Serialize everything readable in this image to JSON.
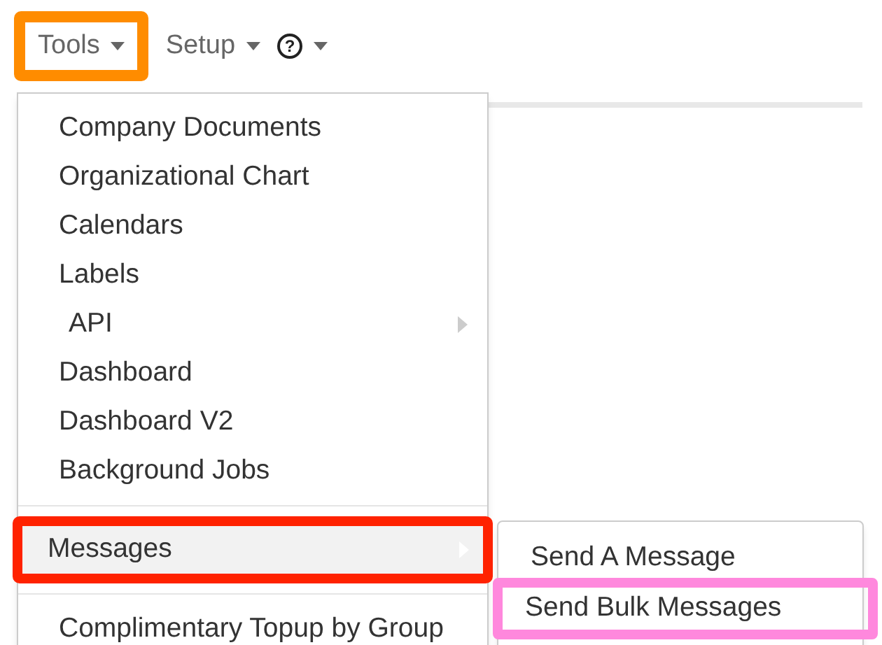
{
  "nav": [
    {
      "label": "Tools",
      "kind": "text",
      "color": "#ff8c00"
    },
    {
      "label": "Setup",
      "kind": "text"
    },
    {
      "label": "?",
      "kind": "icon"
    }
  ],
  "menu": {
    "items": [
      {
        "label": "Company Documents",
        "submenu": false,
        "selected": false
      },
      {
        "label": "Organizational Chart",
        "submenu": false,
        "selected": false
      },
      {
        "label": "Calendars",
        "submenu": false,
        "selected": false
      },
      {
        "label": "Labels",
        "submenu": false,
        "selected": false
      },
      {
        "label": "API",
        "submenu": true,
        "selected": false
      },
      {
        "label": "Dashboard",
        "submenu": false,
        "selected": false
      },
      {
        "label": "Dashboard V2",
        "submenu": false,
        "selected": false
      },
      {
        "label": "Background Jobs",
        "submenu": false,
        "selected": false
      },
      {
        "label": "Messages",
        "submenu": true,
        "selected": true,
        "divider_before": true,
        "color": "#ff2200"
      },
      {
        "label": "Complimentary Topup by Group",
        "submenu": false,
        "selected": false,
        "divider_before": true
      }
    ]
  },
  "submenu": {
    "items": [
      {
        "label": "Send A Message"
      },
      {
        "label": "Send Bulk Messages",
        "color": "#ff88dd"
      }
    ]
  }
}
